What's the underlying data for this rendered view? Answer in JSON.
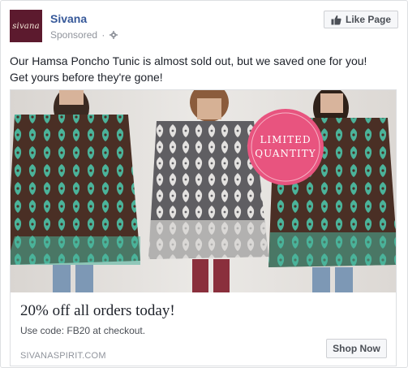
{
  "post": {
    "page_name": "Sivana",
    "avatar_text": "sivana",
    "sponsored_label": "Sponsored",
    "sponsored_sep": "·",
    "like_button_label": "Like Page",
    "message_line1": "Our Hamsa Poncho Tunic is almost sold out, but we saved one for you!",
    "message_line2": "Get yours before they're gone!"
  },
  "ad": {
    "badge_line1": "LIMITED",
    "badge_line2": "QUANTITY",
    "headline": "20% off all orders today!",
    "description": "Use code: FB20 at checkout.",
    "domain": "SIVANASPIRIT.COM",
    "cta_label": "Shop Now"
  },
  "colors": {
    "link_blue": "#365899",
    "badge_pink": "#e8547f",
    "poncho_teal": "#4bb39a",
    "poncho_brown": "#4a2f25"
  },
  "icons": [
    "gear-icon",
    "thumbs-up-icon"
  ]
}
